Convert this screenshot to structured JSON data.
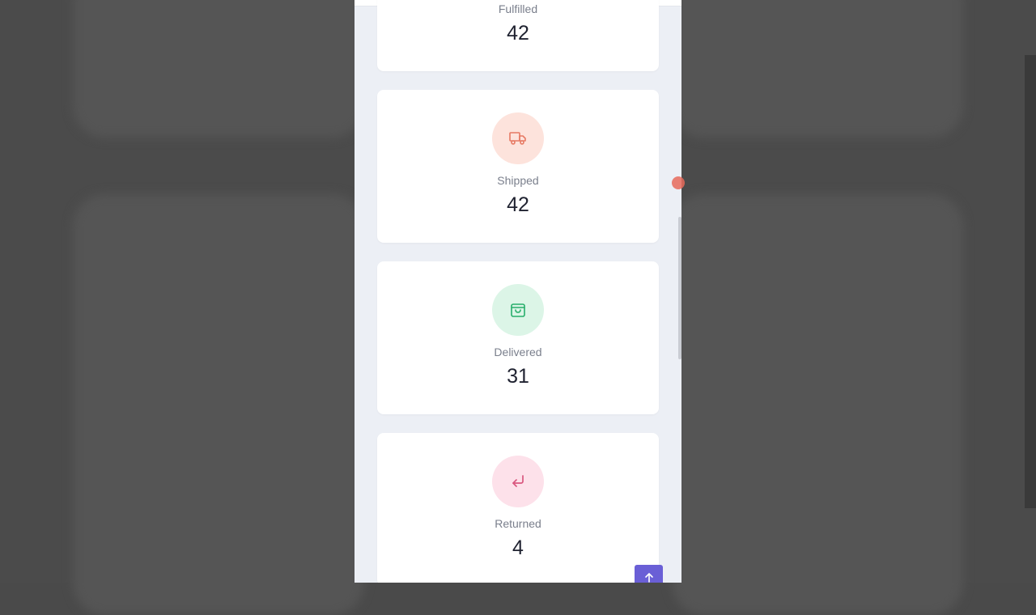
{
  "cards": [
    {
      "key": "fulfilled",
      "label": "Fulfilled",
      "value": "42"
    },
    {
      "key": "shipped",
      "label": "Shipped",
      "value": "42",
      "icon": "truck-icon",
      "icon_color": "#e77a64",
      "circle_color": "#fde3dc"
    },
    {
      "key": "delivered",
      "label": "Delivered",
      "value": "31",
      "icon": "shopping-bag-icon",
      "icon_color": "#27ae6b",
      "circle_color": "#dcf5e7"
    },
    {
      "key": "returned",
      "label": "Returned",
      "value": "4",
      "icon": "return-arrow-icon",
      "icon_color": "#d9577f",
      "circle_color": "#fde1ea"
    }
  ],
  "scroll_top_button": {
    "icon": "arrow-up-icon",
    "color": "#6a5fd6"
  }
}
